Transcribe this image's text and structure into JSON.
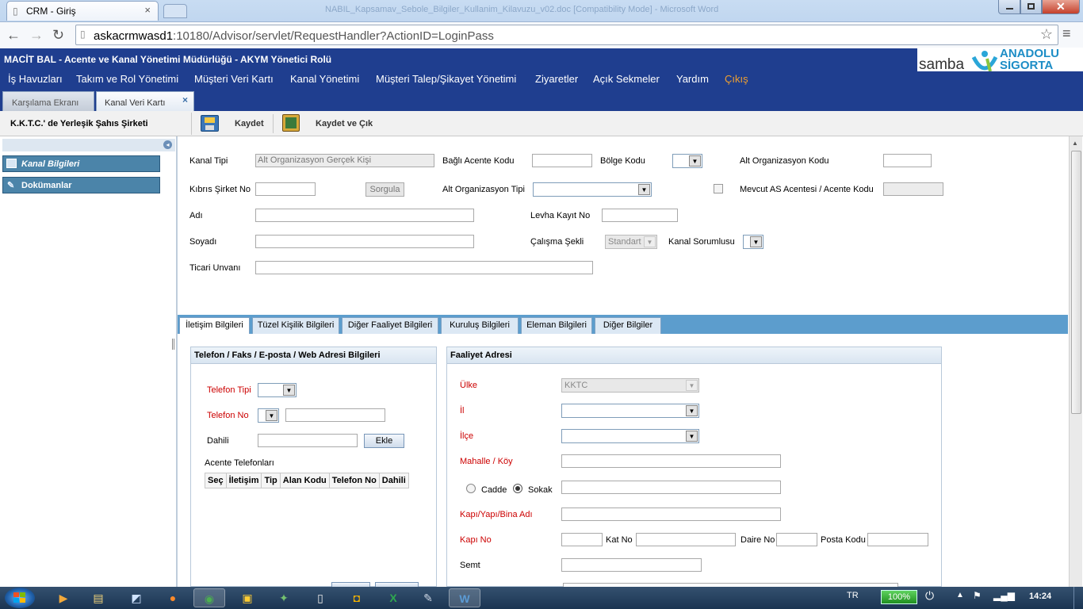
{
  "browser": {
    "tab_title": "CRM - Giriş",
    "window_title_faded": "NABIL_Kapsamav_Sebole_Bilgiler_Kullanim_Kilavuzu_v02.doc [Compatibility Mode] - Microsoft Word",
    "url_host": "askacrmwasd1",
    "url_rest": ":10180/Advisor/servlet/RequestHandler?ActionID=LoginPass"
  },
  "app": {
    "title": "MACİT BAL - Acente ve Kanal Yönetimi Müdürlüğü - AKYM Yönetici Rolü",
    "logo_left": "samba",
    "logo_right_1": "ANADOLU",
    "logo_right_2": "SİGORTA",
    "menu": [
      "İş Havuzları",
      "Takım ve Rol Yönetimi",
      "Müşteri Veri Kartı",
      "Kanal Yönetimi",
      "Müşteri Talep/Şikayet Yönetimi",
      "Ziyaretler",
      "Açık Sekmeler",
      "Yardım",
      "Çıkış"
    ],
    "page_tabs": [
      "Karşılama Ekranı",
      "Kanal Veri Kartı"
    ],
    "page_tab_close": "×",
    "record_title": "K.K.T.C.' de Yerleşik Şahıs Şirketi",
    "save_label": "Kaydet",
    "save_exit_label": "Kaydet ve Çık"
  },
  "left_panel": {
    "items": [
      "Kanal Bilgileri",
      "Dokümanlar"
    ]
  },
  "form": {
    "kanal_tipi_label": "Kanal Tipi",
    "kanal_tipi_value": "Alt Organizasyon Gerçek Kişi",
    "bagli_acente_label": "Bağlı Acente Kodu",
    "bolge_kodu_label": "Bölge Kodu",
    "alt_org_kodu_label": "Alt Organizasyon Kodu",
    "kibris_sirket_label": "Kıbrıs Şirket No",
    "sorgula_label": "Sorgula",
    "alt_org_tipi_label": "Alt Organizasyon Tipi",
    "mevcut_as_label": "Mevcut AS Acentesi / Acente Kodu",
    "adi_label": "Adı",
    "levha_label": "Levha Kayıt No",
    "soyadi_label": "Soyadı",
    "calisma_label": "Çalışma Şekli",
    "calisma_value": "Standart",
    "kanal_sorumlusu_label": "Kanal Sorumlusu",
    "ticari_label": "Ticari Unvanı"
  },
  "subtabs": [
    "İletişim Bilgileri",
    "Tüzel Kişilik Bilgileri",
    "Diğer Faaliyet Bilgileri",
    "Kuruluş Bilgileri",
    "Eleman Bilgileri",
    "Diğer Bilgiler"
  ],
  "contact": {
    "header": "Telefon / Faks / E-posta / Web Adresi Bilgileri",
    "telefon_tipi": "Telefon Tipi",
    "telefon_no": "Telefon No",
    "dahili": "Dahili",
    "ekle": "Ekle",
    "acente_tel": "Acente Telefonları",
    "columns": [
      "Seç",
      "İletişim",
      "Tip",
      "Alan Kodu",
      "Telefon No",
      "Dahili"
    ]
  },
  "address": {
    "header": "Faaliyet Adresi",
    "ulke": "Ülke",
    "ulke_value": "KKTC",
    "il": "İl",
    "ilce": "İlçe",
    "mahalle": "Mahalle / Köy",
    "cadde": "Cadde",
    "sokak": "Sokak",
    "kapi_bina": "Kapı/Yapı/Bina Adı",
    "kapi_no": "Kapı No",
    "kat_no": "Kat No",
    "daire_no": "Daire No",
    "posta": "Posta Kodu",
    "semt": "Semt"
  },
  "taskbar": {
    "lang": "TR",
    "battery": "100%",
    "time": "14:24"
  }
}
